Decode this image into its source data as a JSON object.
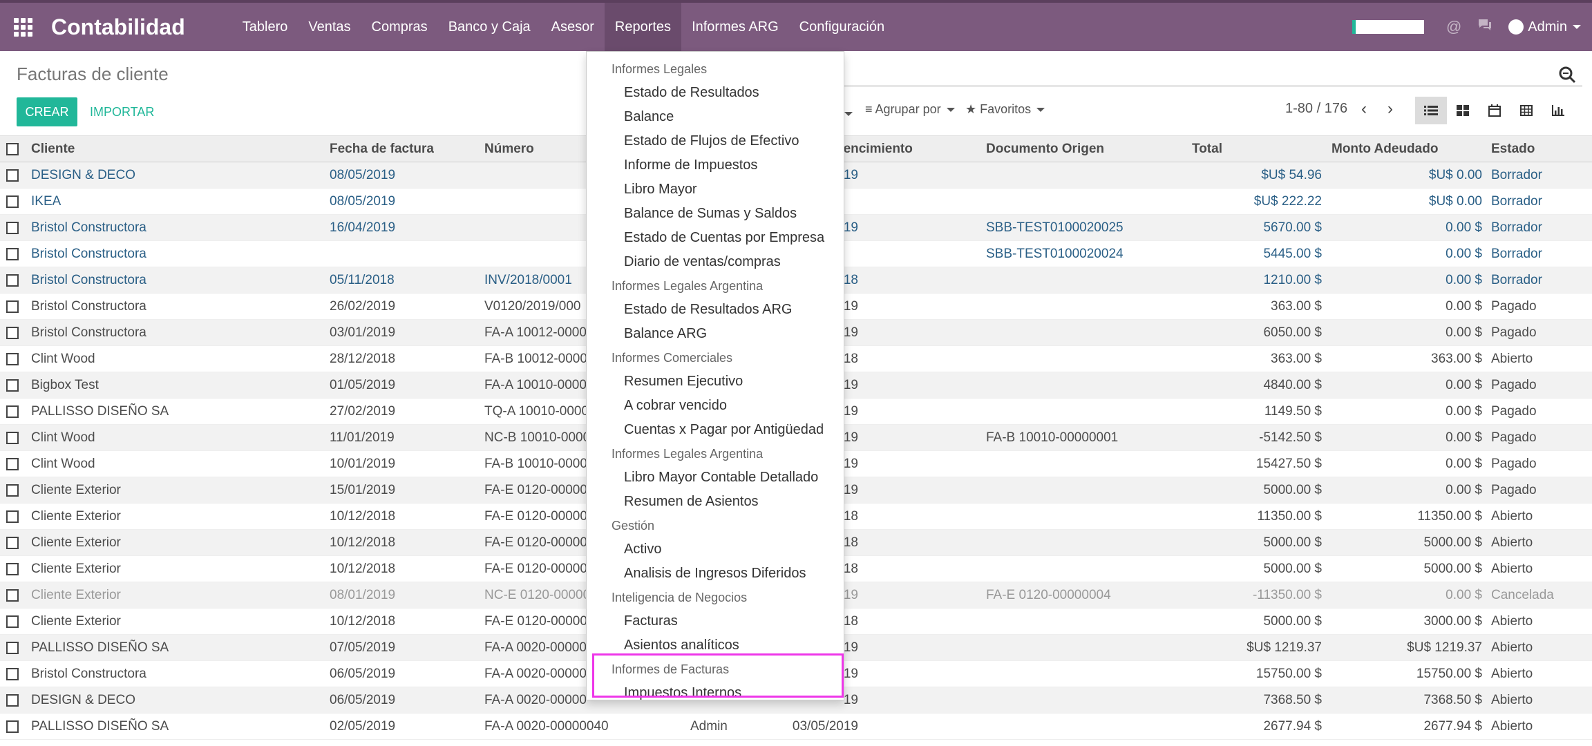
{
  "navbar": {
    "brand": "Contabilidad",
    "menus": [
      "Tablero",
      "Ventas",
      "Compras",
      "Banco y Caja",
      "Asesor",
      "Reportes",
      "Informes ARG",
      "Configuración"
    ],
    "user": "Admin",
    "icons": [
      "apps-icon",
      "at-icon",
      "chat-icon",
      "user-avatar"
    ],
    "color": "#7c5a7e"
  },
  "control": {
    "title": "Facturas de cliente",
    "create_label": "CREAR",
    "import_label": "IMPORTAR",
    "group_by_label": "Agrupar por",
    "favorites_label": "Favoritos",
    "pager": "1-80 / 176"
  },
  "table": {
    "columns": [
      "Cliente",
      "Fecha de factura",
      "Número",
      "",
      "vencimiento",
      "Documento Origen",
      "Total",
      "Monto Adeudado",
      "Estado"
    ],
    "rows": [
      {
        "cliente": "DESIGN & DECO",
        "fecha": "08/05/2019",
        "numero": "",
        "vend": "",
        "venc": "19",
        "origen": "",
        "total": "$U$ 54.96",
        "adeudado": "$U$ 0.00",
        "estado": "Borrador",
        "style": "draft"
      },
      {
        "cliente": "IKEA",
        "fecha": "08/05/2019",
        "numero": "",
        "vend": "",
        "venc": "",
        "origen": "",
        "total": "$U$ 222.22",
        "adeudado": "$U$ 0.00",
        "estado": "Borrador",
        "style": "draft"
      },
      {
        "cliente": "Bristol Constructora",
        "fecha": "16/04/2019",
        "numero": "",
        "vend": "",
        "venc": "19",
        "origen": "SBB-TEST0100020025",
        "total": "5670.00 $",
        "adeudado": "0.00 $",
        "estado": "Borrador",
        "style": "draft"
      },
      {
        "cliente": "Bristol Constructora",
        "fecha": "",
        "numero": "",
        "vend": "",
        "venc": "",
        "origen": "SBB-TEST0100020024",
        "total": "5445.00 $",
        "adeudado": "0.00 $",
        "estado": "Borrador",
        "style": "draft"
      },
      {
        "cliente": "Bristol Constructora",
        "fecha": "05/11/2018",
        "numero": "INV/2018/0001",
        "vend": "",
        "venc": "18",
        "origen": "",
        "total": "1210.00 $",
        "adeudado": "0.00 $",
        "estado": "Borrador",
        "style": "draft"
      },
      {
        "cliente": "Bristol Constructora",
        "fecha": "26/02/2019",
        "numero": "V0120/2019/000",
        "vend": "",
        "venc": "19",
        "origen": "",
        "total": "363.00 $",
        "adeudado": "0.00 $",
        "estado": "Pagado",
        "style": ""
      },
      {
        "cliente": "Bristol Constructora",
        "fecha": "03/01/2019",
        "numero": "FA-A 10012-0000",
        "vend": "",
        "venc": "19",
        "origen": "",
        "total": "6050.00 $",
        "adeudado": "0.00 $",
        "estado": "Pagado",
        "style": ""
      },
      {
        "cliente": "Clint Wood",
        "fecha": "28/12/2018",
        "numero": "FA-B 10012-0000",
        "vend": "",
        "venc": "18",
        "origen": "",
        "total": "363.00 $",
        "adeudado": "363.00 $",
        "estado": "Abierto",
        "style": ""
      },
      {
        "cliente": "Bigbox Test",
        "fecha": "01/05/2019",
        "numero": "FA-A 10010-0000",
        "vend": "",
        "venc": "19",
        "origen": "",
        "total": "4840.00 $",
        "adeudado": "0.00 $",
        "estado": "Pagado",
        "style": ""
      },
      {
        "cliente": "PALLISSO DISEÑO SA",
        "fecha": "27/02/2019",
        "numero": "TQ-A 10010-0000",
        "vend": "",
        "venc": "19",
        "origen": "",
        "total": "1149.50 $",
        "adeudado": "0.00 $",
        "estado": "Pagado",
        "style": ""
      },
      {
        "cliente": "Clint Wood",
        "fecha": "11/01/2019",
        "numero": "NC-B 10010-0000",
        "vend": "",
        "venc": "19",
        "origen": "FA-B 10010-00000001",
        "total": "-5142.50 $",
        "adeudado": "0.00 $",
        "estado": "Pagado",
        "style": ""
      },
      {
        "cliente": "Clint Wood",
        "fecha": "10/01/2019",
        "numero": "FA-B 10010-0000",
        "vend": "",
        "venc": "19",
        "origen": "",
        "total": "15427.50 $",
        "adeudado": "0.00 $",
        "estado": "Pagado",
        "style": ""
      },
      {
        "cliente": "Cliente Exterior",
        "fecha": "15/01/2019",
        "numero": "FA-E 0120-00000",
        "vend": "",
        "venc": "19",
        "origen": "",
        "total": "5000.00 $",
        "adeudado": "0.00 $",
        "estado": "Pagado",
        "style": ""
      },
      {
        "cliente": "Cliente Exterior",
        "fecha": "10/12/2018",
        "numero": "FA-E 0120-00000",
        "vend": "",
        "venc": "18",
        "origen": "",
        "total": "11350.00 $",
        "adeudado": "11350.00 $",
        "estado": "Abierto",
        "style": ""
      },
      {
        "cliente": "Cliente Exterior",
        "fecha": "10/12/2018",
        "numero": "FA-E 0120-00000",
        "vend": "",
        "venc": "18",
        "origen": "",
        "total": "5000.00 $",
        "adeudado": "5000.00 $",
        "estado": "Abierto",
        "style": ""
      },
      {
        "cliente": "Cliente Exterior",
        "fecha": "10/12/2018",
        "numero": "FA-E 0120-00000",
        "vend": "",
        "venc": "18",
        "origen": "",
        "total": "5000.00 $",
        "adeudado": "5000.00 $",
        "estado": "Abierto",
        "style": ""
      },
      {
        "cliente": "Cliente Exterior",
        "fecha": "08/01/2019",
        "numero": "NC-E 0120-00000",
        "vend": "",
        "venc": "19",
        "origen": "FA-E 0120-00000004",
        "total": "-11350.00 $",
        "adeudado": "0.00 $",
        "estado": "Cancelada",
        "style": "cancel"
      },
      {
        "cliente": "Cliente Exterior",
        "fecha": "10/12/2018",
        "numero": "FA-E 0120-00000",
        "vend": "",
        "venc": "18",
        "origen": "",
        "total": "5000.00 $",
        "adeudado": "3000.00 $",
        "estado": "Abierto",
        "style": ""
      },
      {
        "cliente": "PALLISSO DISEÑO SA",
        "fecha": "07/05/2019",
        "numero": "FA-A 0020-00000",
        "vend": "",
        "venc": "19",
        "origen": "",
        "total": "$U$ 1219.37",
        "adeudado": "$U$ 1219.37",
        "estado": "Abierto",
        "style": ""
      },
      {
        "cliente": "Bristol Constructora",
        "fecha": "06/05/2019",
        "numero": "FA-A 0020-00000",
        "vend": "",
        "venc": "19",
        "origen": "",
        "total": "15750.00 $",
        "adeudado": "15750.00 $",
        "estado": "Abierto",
        "style": ""
      },
      {
        "cliente": "DESIGN & DECO",
        "fecha": "06/05/2019",
        "numero": "FA-A 0020-00000",
        "vend": "",
        "venc": "19",
        "origen": "",
        "total": "7368.50 $",
        "adeudado": "7368.50 $",
        "estado": "Abierto",
        "style": ""
      },
      {
        "cliente": "PALLISSO DISEÑO SA",
        "fecha": "02/05/2019",
        "numero": "FA-A 0020-00000040",
        "vend": "Admin",
        "venc": "03/05/2019",
        "origen": "",
        "total": "2677.94 $",
        "adeudado": "2677.94 $",
        "estado": "Abierto",
        "style": ""
      }
    ]
  },
  "dropdown": {
    "entries": [
      {
        "type": "header",
        "label": "Informes Legales"
      },
      {
        "type": "item",
        "label": "Estado de Resultados"
      },
      {
        "type": "item",
        "label": "Balance"
      },
      {
        "type": "item",
        "label": "Estado de Flujos de Efectivo"
      },
      {
        "type": "item",
        "label": "Informe de Impuestos"
      },
      {
        "type": "item",
        "label": "Libro Mayor"
      },
      {
        "type": "item",
        "label": "Balance de Sumas y Saldos"
      },
      {
        "type": "item",
        "label": "Estado de Cuentas por Empresa"
      },
      {
        "type": "item",
        "label": "Diario de ventas/compras"
      },
      {
        "type": "header",
        "label": "Informes Legales Argentina"
      },
      {
        "type": "item",
        "label": "Estado de Resultados ARG"
      },
      {
        "type": "item",
        "label": "Balance ARG"
      },
      {
        "type": "header",
        "label": "Informes Comerciales"
      },
      {
        "type": "item",
        "label": "Resumen Ejecutivo"
      },
      {
        "type": "item",
        "label": "A cobrar vencido"
      },
      {
        "type": "item",
        "label": "Cuentas x Pagar por Antigüedad"
      },
      {
        "type": "header",
        "label": "Informes Legales Argentina"
      },
      {
        "type": "item",
        "label": "Libro Mayor Contable Detallado"
      },
      {
        "type": "item",
        "label": "Resumen de Asientos"
      },
      {
        "type": "header",
        "label": "Gestión"
      },
      {
        "type": "item",
        "label": "Activo"
      },
      {
        "type": "item",
        "label": "Analisis de Ingresos Diferidos"
      },
      {
        "type": "header",
        "label": "Inteligencia de Negocios"
      },
      {
        "type": "item",
        "label": "Facturas"
      },
      {
        "type": "item",
        "label": "Asientos analíticos"
      },
      {
        "type": "header",
        "label": "Informes de Facturas"
      },
      {
        "type": "item",
        "label": "Impuestos Internos"
      }
    ]
  },
  "colors": {
    "accent": "#21b799",
    "draft_text": "#2a5f86",
    "highlight": "#ee36e9",
    "navbar": "#7c5a7e"
  }
}
